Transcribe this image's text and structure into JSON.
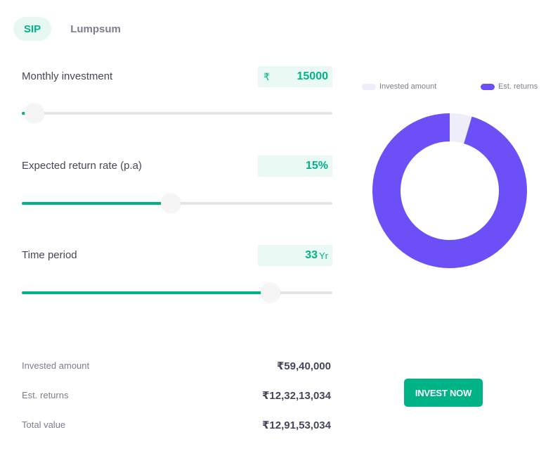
{
  "tabs": [
    {
      "label": "SIP",
      "active": true
    },
    {
      "label": "Lumpsum",
      "active": false
    }
  ],
  "inputs": {
    "monthly": {
      "label": "Monthly investment",
      "prefix": "₹",
      "value": "15000",
      "slider_fraction": 0.04
    },
    "rate": {
      "label": "Expected return rate (p.a)",
      "value": "15%",
      "slider_fraction": 0.48
    },
    "period": {
      "label": "Time period",
      "value": "33",
      "suffix": "Yr",
      "slider_fraction": 0.8
    }
  },
  "legend": {
    "invested": {
      "label": "Invested amount",
      "color": "#eeeefb"
    },
    "returns": {
      "label": "Est. returns",
      "color": "#6c4ff6"
    }
  },
  "chart_data": {
    "type": "pie",
    "categories": [
      "Invested amount",
      "Est. returns"
    ],
    "values": [
      5940000,
      122130000
    ]
  },
  "summary": {
    "invested": {
      "label": "Invested amount",
      "value": "₹59,40,000"
    },
    "returns": {
      "label": "Est. returns",
      "value": "₹12,32,13,034"
    },
    "total": {
      "label": "Total value",
      "value": "₹12,91,53,034"
    }
  },
  "cta": {
    "label": "INVEST NOW",
    "color": "#00b386"
  }
}
